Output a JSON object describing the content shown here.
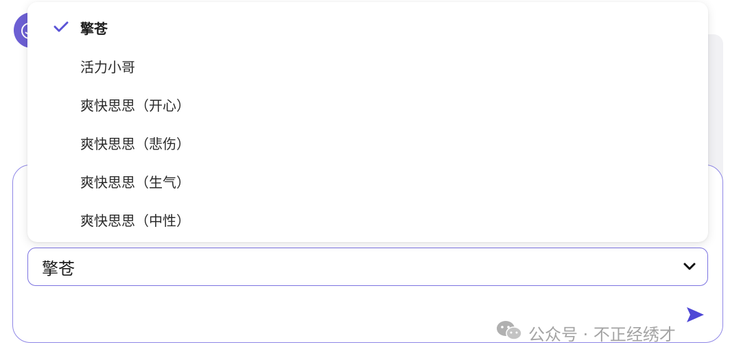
{
  "voice_dropdown": {
    "options": [
      {
        "label": "擎苍",
        "selected": true
      },
      {
        "label": "活力小哥",
        "selected": false
      },
      {
        "label": "爽快思思（开心）",
        "selected": false
      },
      {
        "label": "爽快思思（悲伤）",
        "selected": false
      },
      {
        "label": "爽快思思（生气）",
        "selected": false
      },
      {
        "label": "爽快思思（中性）",
        "selected": false
      }
    ],
    "selected_value": "擎苍"
  },
  "icons": {
    "check": "check-icon",
    "chevron": "chevron-down-icon",
    "send": "send-icon",
    "wechat": "wechat-icon"
  },
  "colors": {
    "accent": "#5b54d6",
    "border": "#7b72e0"
  },
  "watermark": {
    "text": "公众号 · 不正经绣才"
  }
}
